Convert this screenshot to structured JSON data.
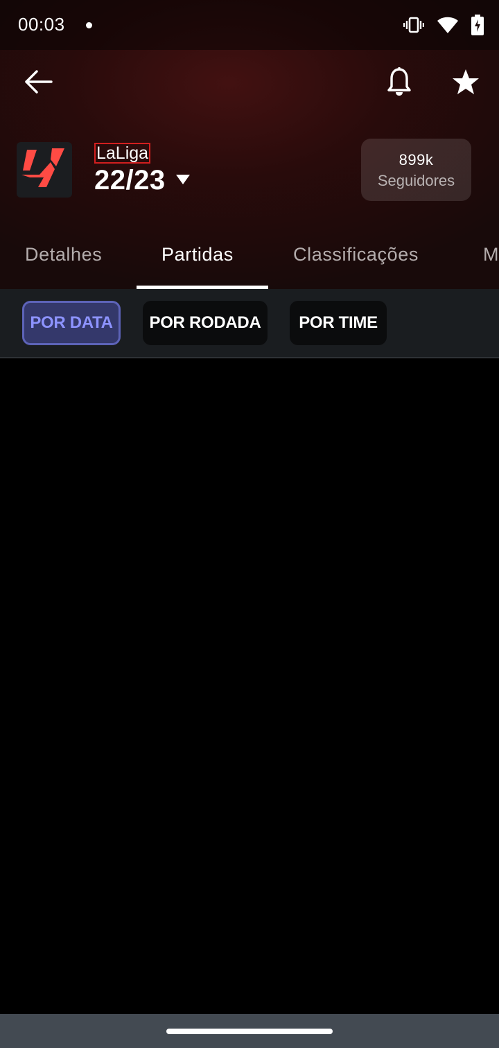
{
  "status_bar": {
    "time": "00:03",
    "icons": [
      "vibrate-icon",
      "wifi-icon",
      "battery-charging-icon"
    ]
  },
  "app_bar": {
    "back_icon": "arrow-left-icon",
    "notification_icon": "bell-icon",
    "favorite_icon": "star-icon"
  },
  "league": {
    "name": "LaLiga",
    "season": "22/23",
    "logo_icon": "laliga-logo",
    "logo_color": "#ff4b44",
    "followers_count": "899k",
    "followers_label": "Seguidores"
  },
  "tabs": [
    {
      "label": "Detalhes",
      "active": false
    },
    {
      "label": "Partidas",
      "active": true
    },
    {
      "label": "Classificações",
      "active": false
    },
    {
      "label": "M",
      "active": false
    }
  ],
  "filters": [
    {
      "label": "POR DATA",
      "selected": true
    },
    {
      "label": "POR RODADA",
      "selected": false
    },
    {
      "label": "POR TIME",
      "selected": false
    }
  ],
  "colors": {
    "accent_selected_text": "#8d93ff",
    "accent_selected_bg": "#34386b",
    "filter_bar_bg": "#1a1d20"
  }
}
